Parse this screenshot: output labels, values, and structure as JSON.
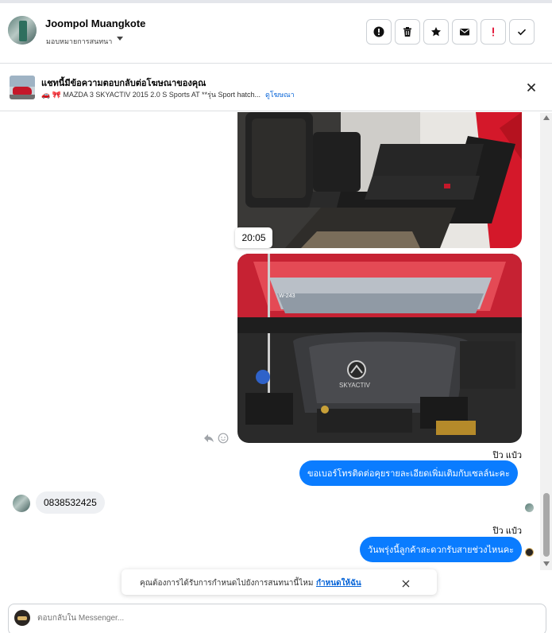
{
  "header": {
    "contact_name": "Joompol Muangkote",
    "assign_label": "มอบหมายการสนทนา",
    "action_icons": [
      "alert-circle-icon",
      "trash-icon",
      "star-icon",
      "mail-icon",
      "exclamation-icon",
      "checkmark-icon"
    ]
  },
  "ad_notice": {
    "title": "แชทนี้มีข้อความตอบกลับต่อโฆษณาของคุณ",
    "ad_text": "🚗 🎀 MAZDA 3 SKYACTIV 2015 2.0 S Sports AT **รุ่น Sport hatch...",
    "view_ad_link": "ดูโฆษณา"
  },
  "messages": {
    "photo_timestamp": "20:05",
    "outgoing_1_sender": "ปิว แป๋ว",
    "outgoing_1_text": "ขอเบอร์โทรติดต่อคุยรายละเอียดเพิ่มเติมกับเซลล์นะคะ",
    "incoming_1_text": "0838532425",
    "outgoing_2_sender": "ปิว แป๋ว",
    "outgoing_2_text": "วันพรุ่งนี้ลูกค้าสะดวกรับสายช่วงไหนคะ",
    "hood_badge_text": "W-243",
    "engine_badge_text": "SKYACTIV"
  },
  "followup_prompt": {
    "text": "คุณต้องการได้รับการกำหนดไปยังการสนทนานี้ไหม",
    "link": "กำหนดให้ฉัน"
  },
  "composer": {
    "placeholder": "ตอบกลับใน Messenger..."
  },
  "colors": {
    "accent": "#0a7cff",
    "link": "#0a66d8",
    "alert": "#e41e3f"
  }
}
